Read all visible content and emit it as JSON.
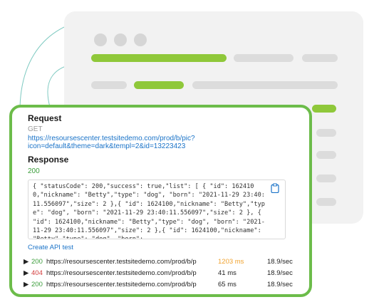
{
  "request": {
    "heading": "Request",
    "method": "GET",
    "url": "https://resoursescenter.testsitedemo.com/prod/b/pic?icon=default&theme=dark&templ=2&id=13223423"
  },
  "response": {
    "heading": "Response",
    "status": "200",
    "body": "{ \"statusCode\": 200,\"success\": true,\"list\": [ { \"id\": 1624100,\"nickname\": \"Betty\",\"type\": \"dog\", \"born\": \"2021-11-29 23:40:11.556097\",\"size\": 2 },{ \"id\": 1624100,\"nickname\": \"Betty\",\"type\": \"dog\", \"born\": \"2021-11-29 23:40:11.556097\",\"size\": 2 }, { \"id\": 1624100,\"nickname\": \"Betty\",\"type\": \"dog\", \"born\": \"2021-11-29 23:40:11.556097\",\"size\": 2 },{ \"id\": 1624100,\"nickname\": \"Betty\",\"type\": \"dog\", \"born\":"
  },
  "create_api_test_label": "Create API test",
  "requests": [
    {
      "status": "200",
      "url": "https://resoursescenter.testsitedemo.com/prod/b/p",
      "time": "1203 ms",
      "rate": "18.9/sec"
    },
    {
      "status": "404",
      "url": "https://resoursescenter.testsitedemo.com/prod/b/p",
      "time": "41 ms",
      "rate": "18.9/sec"
    },
    {
      "status": "200",
      "url": "https://resoursescenter.testsitedemo.com/prod/b/p",
      "time": "65 ms",
      "rate": "18.9/sec"
    }
  ],
  "colors": {
    "accent_green": "#6cbc4a",
    "skeleton_green": "#8fc83a",
    "link_blue": "#1a73c8",
    "status_ok": "#3a9d3a",
    "status_error": "#d23a3a",
    "slow_time": "#f0a22e"
  },
  "icons": {
    "copy": "clipboard-icon",
    "expand": "triangle-right-icon"
  }
}
